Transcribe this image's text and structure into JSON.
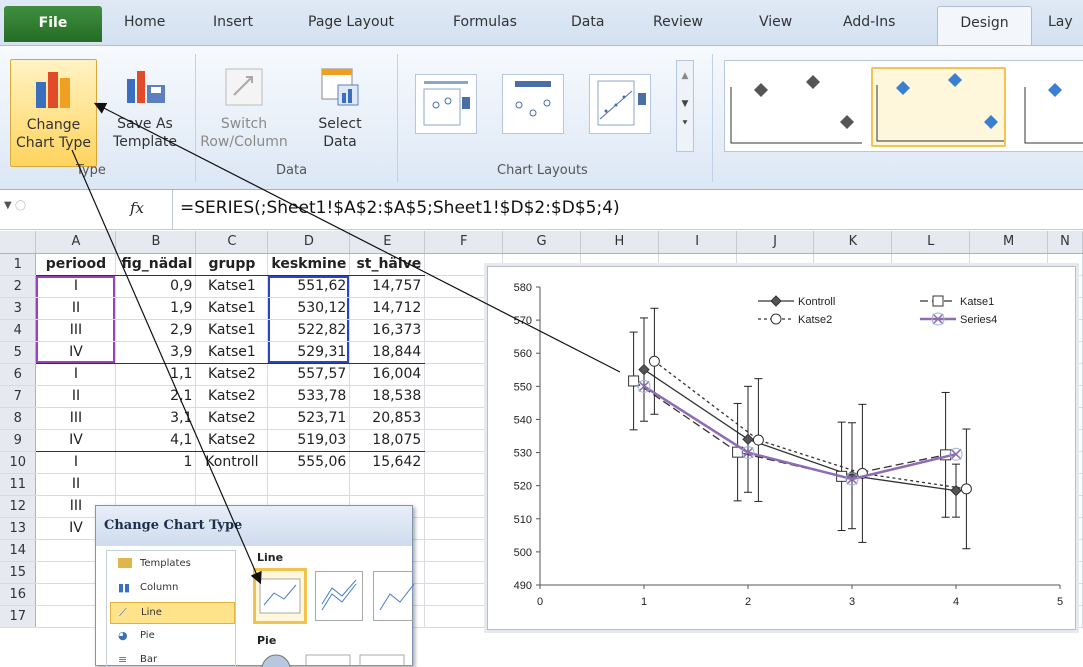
{
  "tabs": [
    "File",
    "Home",
    "Insert",
    "Page Layout",
    "Formulas",
    "Data",
    "Review",
    "View",
    "Add-Ins",
    "Design",
    "Lay"
  ],
  "ribbon": {
    "type_group": {
      "label": "Type",
      "change_chart_type": [
        "Change",
        "Chart Type"
      ],
      "save_as_template": [
        "Save As",
        "Template"
      ]
    },
    "data_group": {
      "label": "Data",
      "switch": [
        "Switch",
        "Row/Column"
      ],
      "select": [
        "Select",
        "Data"
      ]
    },
    "layouts_group": {
      "label": "Chart Layouts"
    }
  },
  "formula_bar": {
    "fx": "fx",
    "formula": "=SERIES(;Sheet1!$A$2:$A$5;Sheet1!$D$2:$D$5;4)"
  },
  "columns": [
    "A",
    "B",
    "C",
    "D",
    "E",
    "F",
    "G",
    "H",
    "I",
    "J",
    "K",
    "L",
    "M",
    "N"
  ],
  "rows": [
    [
      "1",
      "periood",
      "fig_nädal",
      "grupp",
      "keskmine",
      "st_hälve"
    ],
    [
      "2",
      "I",
      "0,9",
      "Katse1",
      "551,62",
      "14,757"
    ],
    [
      "3",
      "II",
      "1,9",
      "Katse1",
      "530,12",
      "14,712"
    ],
    [
      "4",
      "III",
      "2,9",
      "Katse1",
      "522,82",
      "16,373"
    ],
    [
      "5",
      "IV",
      "3,9",
      "Katse1",
      "529,31",
      "18,844"
    ],
    [
      "6",
      "I",
      "1,1",
      "Katse2",
      "557,57",
      "16,004"
    ],
    [
      "7",
      "II",
      "2,1",
      "Katse2",
      "533,78",
      "18,538"
    ],
    [
      "8",
      "III",
      "3,1",
      "Katse2",
      "523,71",
      "20,853"
    ],
    [
      "9",
      "IV",
      "4,1",
      "Katse2",
      "519,03",
      "18,075"
    ],
    [
      "10",
      "I",
      "1",
      "Kontroll",
      "555,06",
      "15,642"
    ],
    [
      "11",
      "II",
      "",
      "",
      "",
      "",
      ""
    ],
    [
      "12",
      "III",
      "",
      "",
      "",
      "",
      ""
    ],
    [
      "13",
      "IV",
      "",
      "",
      "",
      "",
      ""
    ],
    [
      "14",
      "",
      "",
      "",
      "",
      "",
      ""
    ],
    [
      "15",
      "",
      "",
      "",
      "",
      "",
      ""
    ],
    [
      "16",
      "",
      "",
      "",
      "",
      "",
      ""
    ],
    [
      "17",
      "",
      "",
      "",
      "",
      "",
      ""
    ]
  ],
  "chart_data": {
    "type": "line",
    "x": [
      1,
      2,
      3,
      4
    ],
    "xlim": [
      0,
      5
    ],
    "ylim": [
      490,
      580
    ],
    "xticks": [
      0,
      1,
      2,
      3,
      4,
      5
    ],
    "yticks": [
      490,
      500,
      510,
      520,
      530,
      540,
      550,
      560,
      570,
      580
    ],
    "legend_position": "top-right",
    "series": [
      {
        "name": "Kontroll",
        "x": [
          1,
          2,
          3,
          4
        ],
        "values": [
          555.06,
          534,
          523,
          518.5
        ],
        "err": [
          15.6,
          16,
          16,
          8
        ],
        "color": "#333333",
        "marker": "diamond",
        "dash": ""
      },
      {
        "name": "Katse1",
        "x": [
          0.9,
          1.9,
          2.9,
          3.9
        ],
        "values": [
          551.62,
          530.12,
          522.82,
          529.31
        ],
        "err": [
          14.757,
          14.712,
          16.373,
          18.844
        ],
        "color": "#333333",
        "marker": "square",
        "dash": "8,4"
      },
      {
        "name": "Katse2",
        "x": [
          1.1,
          2.1,
          3.1,
          4.1
        ],
        "values": [
          557.57,
          533.78,
          523.71,
          519.03
        ],
        "err": [
          16.004,
          18.538,
          20.853,
          18.075
        ],
        "color": "#333333",
        "marker": "circle",
        "dash": "3,3"
      },
      {
        "name": "Series4",
        "x": [
          1,
          2,
          3,
          4
        ],
        "values": [
          550,
          530,
          522,
          529.5
        ],
        "err": [
          0,
          0,
          0,
          0
        ],
        "color": "#8e6bb3",
        "marker": "x",
        "dash": ""
      }
    ]
  },
  "dialog": {
    "title": "Change Chart Type",
    "items": [
      "Templates",
      "Column",
      "Line",
      "Pie",
      "Bar"
    ],
    "section_line": "Line",
    "section_pie": "Pie"
  }
}
